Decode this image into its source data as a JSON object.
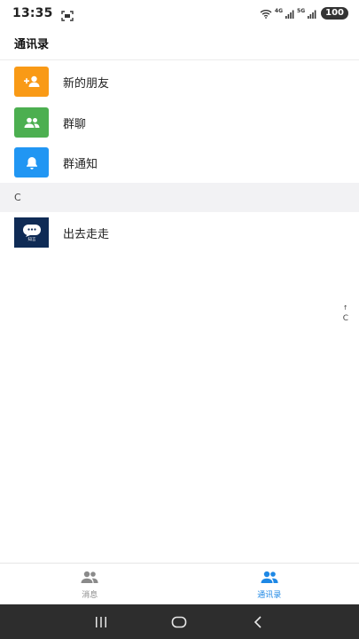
{
  "status_bar": {
    "time": "13:35",
    "network_1": "4G",
    "network_2": "5G",
    "battery": "100"
  },
  "header": {
    "title": "通讯录"
  },
  "shortcuts": [
    {
      "label": "新的朋友",
      "icon": "add-person-icon",
      "color": "#f99a16"
    },
    {
      "label": "群聊",
      "icon": "group-icon",
      "color": "#4caf50"
    },
    {
      "label": "群通知",
      "icon": "bell-icon",
      "color": "#2196f3"
    }
  ],
  "section": {
    "letter": "C"
  },
  "contacts": [
    {
      "name": "出去走走",
      "avatar_text": "知言"
    }
  ],
  "index_bar": {
    "arrow": "↑",
    "letter": "C"
  },
  "tabs": [
    {
      "label": "消息",
      "active": false
    },
    {
      "label": "通讯录",
      "active": true
    }
  ],
  "colors": {
    "accent": "#1e88e5",
    "inactive": "#8a8a8a",
    "section_bg": "#f2f2f4",
    "nav_bg": "#2d2d2d"
  }
}
